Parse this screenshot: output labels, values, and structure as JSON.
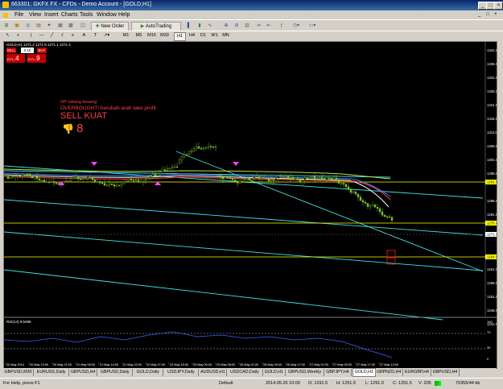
{
  "window": {
    "title": "663301: GKFX FX - CFDs - Demo Account - [GOLD,H1]"
  },
  "menu": [
    "File",
    "View",
    "Insert",
    "Charts",
    "Tools",
    "Window",
    "Help"
  ],
  "toolbar": {
    "new_order": "New Order",
    "autotrading": "AutoTrading"
  },
  "timeframes": [
    "M1",
    "M5",
    "M15",
    "M30",
    "H1",
    "H4",
    "D1",
    "W1",
    "MN"
  ],
  "chart": {
    "header": "GOLD,H1  1271.2 1271.9 1271.1 1271.4",
    "trade_panel": {
      "sell": "SELL",
      "buy": "BUY",
      "lots": "0.10",
      "bid_small": "1271",
      "bid_big": ".4",
      "ask_small": "1271",
      "ask_big": ".9"
    },
    "annotations": {
      "line1": "OP lubang kesang",
      "line2": "OVERBOUGHT! berubah arah take profit",
      "line3": "SELL KUAT",
      "big_digit": "8"
    },
    "price_labels": [
      "1341.5",
      "1336.5",
      "1331.5",
      "1326.5",
      "1321.5",
      "1316.5",
      "1311.5",
      "1306.5",
      "1301.5",
      "1296.5",
      "1291.5",
      "1286.5",
      "1281.5",
      "1276.4",
      "1271.4",
      "1266.5",
      "1261.5",
      "1256.5",
      "1251.5",
      "1246.5",
      "1241.5"
    ],
    "highlight_labels": {
      "upper": "1291.5",
      "mid": "1276.4",
      "current": "1271.4",
      "lower": "1264.0"
    },
    "rsi": {
      "label": "RSI(14) 9.5488",
      "levels": [
        "100",
        "70",
        "30",
        "0"
      ]
    },
    "time_labels": [
      "20 May 2014",
      "20 May 13:00",
      "20 May 21:00",
      "21 May 06:00",
      "21 May 14:00",
      "21 May 22:00",
      "22 May 07:00",
      "22 May 15:00",
      "23 May 00:00",
      "23 May 08:00",
      "26 May 01:00",
      "26 May 09:00",
      "26 May 17:00",
      "27 May 01:00",
      "27 May 09:00",
      "27 May 17:00",
      "27 May 13:00"
    ]
  },
  "tabs": [
    "GBPUSD,M30",
    "EURUSD,Daily",
    "GBPUSD,H4",
    "GBPUSD,Daily",
    "GOLD,Daily",
    "USDJPY,Daily",
    "AUDUSD,H1",
    "USDCAD,Daily",
    "GOLD,H1",
    "GBPUSD,Weekly",
    "GBPJPY,H4",
    "GOLD,H1",
    "GBPNZD,H4",
    "EURGBP,H4",
    "GBPUSD,H4"
  ],
  "active_tab": 11,
  "status": {
    "help": "For Help, press F1",
    "profile": "Default",
    "datetime": "2014.05.26 10:00",
    "open": "O: 1291.5",
    "high": "H: 1291.9",
    "low": "L: 1291.0",
    "close": "C: 1291.5",
    "volume": "V: 205",
    "traffic": "70355/44 kb"
  },
  "colors": {
    "title_gradient": "#0a246a",
    "chart_bg": "#000000",
    "candle_green": "#7cbf2a",
    "trendline": "#40e0e0",
    "hline": "#ffff00",
    "annotation": "#ff4040",
    "arrow": "#ff40ff"
  }
}
